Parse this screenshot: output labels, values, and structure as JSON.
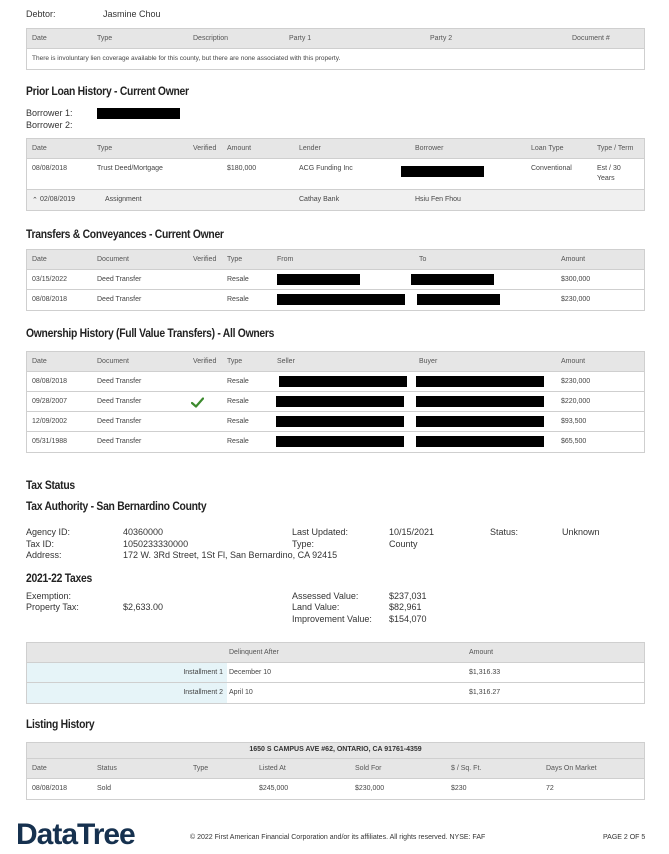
{
  "debtor": {
    "label": "Debtor:",
    "value": "Jasmine Chou"
  },
  "liens": {
    "columns": [
      "Date",
      "Type",
      "Description",
      "Party 1",
      "Party 2",
      "Document #"
    ],
    "note": "There is involuntary lien coverage available for this county, but there are none associated with this property."
  },
  "prior_loan": {
    "title": "Prior Loan History - Current Owner",
    "borrower1": "Borrower 1:",
    "borrower2": "Borrower 2:",
    "columns": [
      "Date",
      "Type",
      "Verified",
      "Amount",
      "Lender",
      "Borrower",
      "Loan Type",
      "Type / Term"
    ],
    "rows": [
      {
        "date": "08/08/2018",
        "type": "Trust Deed/Mortgage",
        "amount": "$180,000",
        "lender": "ACG Funding Inc",
        "loan_type": "Conventional",
        "term1": "Est / 30",
        "term2": "Years"
      }
    ],
    "sub": {
      "date": "02/08/2019",
      "type": "Assignment",
      "lender": "Cathay Bank",
      "borrower": "Hsiu Fen Fhou"
    }
  },
  "transfers": {
    "title": "Transfers & Conveyances - Current Owner",
    "columns": [
      "Date",
      "Document",
      "Verified",
      "Type",
      "From",
      "To",
      "Amount"
    ],
    "rows": [
      {
        "date": "03/15/2022",
        "doc": "Deed Transfer",
        "type": "Resale",
        "amount": "$300,000"
      },
      {
        "date": "08/08/2018",
        "doc": "Deed Transfer",
        "type": "Resale",
        "amount": "$230,000"
      }
    ]
  },
  "ownership": {
    "title": "Ownership History (Full Value Transfers) - All Owners",
    "columns": [
      "Date",
      "Document",
      "Verified",
      "Type",
      "Seller",
      "Buyer",
      "Amount"
    ],
    "rows": [
      {
        "date": "08/08/2018",
        "doc": "Deed Transfer",
        "type": "Resale",
        "amount": "$230,000"
      },
      {
        "date": "09/28/2007",
        "doc": "Deed Transfer",
        "type": "Resale",
        "amount": "$220,000"
      },
      {
        "date": "12/09/2002",
        "doc": "Deed Transfer",
        "type": "Resale",
        "amount": "$93,500"
      },
      {
        "date": "05/31/1988",
        "doc": "Deed Transfer",
        "type": "Resale",
        "amount": "$65,500"
      }
    ]
  },
  "tax": {
    "status_title": "Tax Status",
    "authority_title": "Tax Authority - San Bernardino County",
    "agency_label": "Agency ID:",
    "agency": "40360000",
    "taxid_label": "Tax ID:",
    "taxid": "1050233330000",
    "address_label": "Address:",
    "address": "172 W. 3Rd Street, 1St Fl, San Bernardino, CA 92415",
    "updated_label": "Last Updated:",
    "updated": "10/15/2021",
    "type_label": "Type:",
    "type": "County",
    "status_label": "Status:",
    "status": "Unknown",
    "year_title": "2021-22 Taxes",
    "exemption_label": "Exemption:",
    "proptax_label": "Property Tax:",
    "proptax": "$2,633.00",
    "assessed_label": "Assessed Value:",
    "assessed": "$237,031",
    "land_label": "Land Value:",
    "land": "$82,961",
    "improve_label": "Improvement Value:",
    "improve": "$154,070",
    "install": {
      "col1": "Delinquent After",
      "col2": "Amount",
      "rows": [
        {
          "label": "Installment 1",
          "date": "December 10",
          "amount": "$1,316.33"
        },
        {
          "label": "Installment 2",
          "date": "April 10",
          "amount": "$1,316.27"
        }
      ]
    }
  },
  "listing": {
    "title": "Listing History",
    "address": "1650 S CAMPUS AVE #62, ONTARIO, CA 91761-4359",
    "columns": [
      "Date",
      "Status",
      "Type",
      "Listed At",
      "Sold For",
      "$ / Sq. Ft.",
      "Days On Market"
    ],
    "rows": [
      {
        "date": "08/08/2018",
        "status": "Sold",
        "listed": "$245,000",
        "sold": "$230,000",
        "sqft": "$230",
        "dom": "72"
      }
    ]
  },
  "footer": {
    "logo": "DataTree",
    "copyright": "© 2022 First American Financial Corporation and/or its affiliates. All rights reserved. NYSE: FAF",
    "page": "PAGE 2 OF 5"
  },
  "colors": {
    "logo": "#16314f",
    "check": "#3c8a2e",
    "install_bg": "#e6f4f8"
  }
}
